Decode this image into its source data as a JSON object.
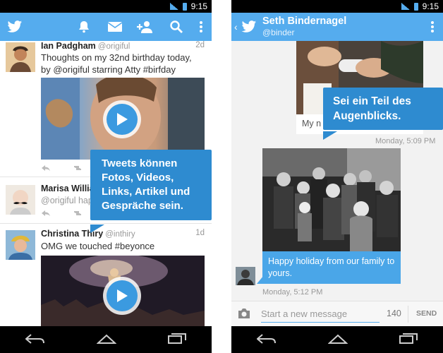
{
  "status": {
    "time": "9:15"
  },
  "left": {
    "toolbar_icons": [
      "twitter-bird-icon",
      "bell-icon",
      "envelope-icon",
      "add-user-icon",
      "search-icon",
      "overflow-menu-icon"
    ],
    "tweets": [
      {
        "name": "Ian Padgham",
        "handle": "@origiful",
        "time": "2d",
        "text": "Thoughts on my 32nd birthday today, by @origiful starring Atty #birfday"
      },
      {
        "name": "Marisa Willia",
        "handle": "@origiful hap",
        "time": ""
      },
      {
        "name": "Christina Thiry",
        "handle": "@inthiry",
        "time": "1d",
        "text": "OMG we touched #beyonce"
      }
    ],
    "callout": "Tweets können Fotos, Videos, Links, Artikel und Gespräche sein."
  },
  "right": {
    "title": "Seth Bindernagel",
    "handle": "@binder",
    "partial_message": "My n",
    "callout": "Sei ein Teil des Augenblicks.",
    "time1": "Monday, 5:09 PM",
    "message": "Happy holiday from our family to yours.",
    "time2": "Monday, 5:12 PM",
    "compose_placeholder": "Start a new message",
    "char_count": "140",
    "send_label": "SEND"
  },
  "colors": {
    "twitter_blue": "#55acee",
    "callout_blue": "#2e8bd0",
    "message_blue": "#4aa6e8"
  }
}
